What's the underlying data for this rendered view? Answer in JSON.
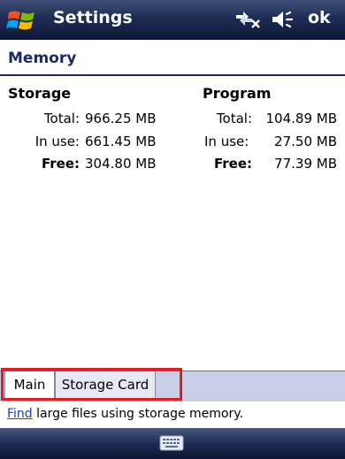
{
  "titlebar": {
    "title": "Settings",
    "ok_label": "ok"
  },
  "section": {
    "title": "Memory"
  },
  "storage": {
    "heading": "Storage",
    "total_label": "Total:",
    "total_value": "966.25 MB",
    "inuse_label": "In use:",
    "inuse_value": "661.45 MB",
    "free_label": "Free:",
    "free_value": "304.80 MB"
  },
  "program": {
    "heading": "Program",
    "total_label": "Total:",
    "total_value": "104.89 MB",
    "inuse_label": "In use:",
    "inuse_value": "27.50 MB",
    "free_label": "Free:",
    "free_value": "77.39 MB"
  },
  "tabs": [
    {
      "label": "Main"
    },
    {
      "label": "Storage Card"
    }
  ],
  "hint": {
    "link": "Find",
    "text": " large files using storage memory."
  },
  "icons": {
    "start": "windows-start-icon",
    "connectivity": "connectivity-icon",
    "volume": "speaker-volume-icon",
    "keyboard": "keyboard-icon"
  },
  "colors": {
    "titlebar": "#1f2d55",
    "section_title": "#1c2a6b",
    "tab_strip": "#c7cee6",
    "highlight": "#e31b23",
    "link": "#1a3fb8"
  }
}
